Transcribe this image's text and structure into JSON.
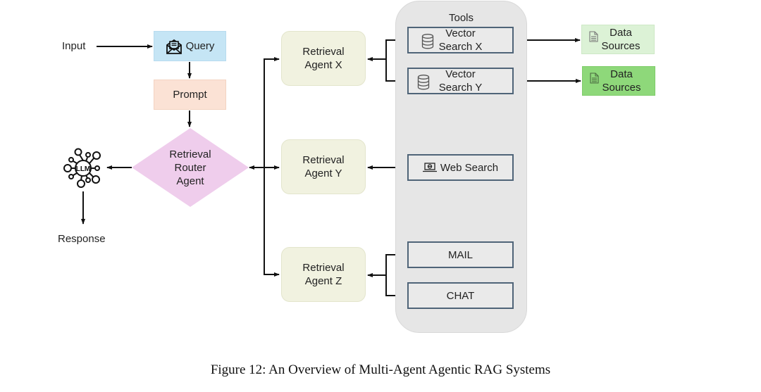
{
  "diagram": {
    "input_label": "Input",
    "query": {
      "label": "Query",
      "icon": "envelope-document-icon"
    },
    "prompt": {
      "label": "Prompt"
    },
    "router": {
      "line1": "Retrieval",
      "line2": "Router",
      "line3": "Agent"
    },
    "llm": {
      "label": "LLM",
      "icon": "llm-network-icon"
    },
    "response_label": "Response",
    "agents": [
      {
        "line1": "Retrieval",
        "line2": "Agent X"
      },
      {
        "line1": "Retrieval",
        "line2": "Agent Y"
      },
      {
        "line1": "Retrieval",
        "line2": "Agent Z"
      }
    ],
    "tools": {
      "title": "Tools",
      "items": [
        {
          "line1": "Vector",
          "line2": "Search X",
          "icon": "database-icon"
        },
        {
          "line1": "Vector",
          "line2": "Search Y",
          "icon": "database-icon"
        },
        {
          "label": "Web Search",
          "icon": "laptop-globe-icon"
        },
        {
          "label": "MAIL"
        },
        {
          "label": "CHAT"
        }
      ]
    },
    "data_sources": [
      {
        "line1": "Data",
        "line2": "Sources",
        "icon": "document-icon",
        "color": "#dcf2d6"
      },
      {
        "line1": "Data",
        "line2": "Sources",
        "icon": "document-icon",
        "color": "#8ed87a"
      }
    ],
    "colors": {
      "query": "#c5e5f5",
      "prompt": "#fbe2d5",
      "router": "#efcdec",
      "agent": "#f1f2e0",
      "tools_panel": "#e6e6e6",
      "tool_border": "#4f6478"
    }
  },
  "caption": "Figure 12: An Overview of Multi-Agent Agentic RAG Systems"
}
